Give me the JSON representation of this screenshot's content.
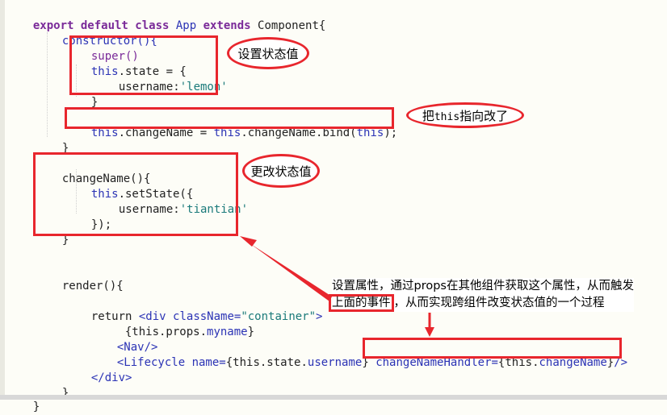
{
  "code": {
    "l1": {
      "a": "export default ",
      "b": "class ",
      "c": "App ",
      "d": "extends ",
      "e": "Component{"
    },
    "l2": {
      "a": "constructor(){"
    },
    "l3": {
      "a": "super()"
    },
    "l4": {
      "a": "this",
      ".b": "",
      "b": ".state = {"
    },
    "l5": {
      "a": "username:",
      "b": "'lemon'"
    },
    "l6": {
      "a": "}"
    },
    "l7": {
      "a": "this",
      "b": ".changeName = ",
      "c": "this",
      "d": ".changeName.bind(",
      "e": "this",
      "f": ");"
    },
    "l8": {
      "a": "}"
    },
    "l9": {
      "a": "changeName(){"
    },
    "l10": {
      "a": "this",
      "b": ".setState({"
    },
    "l11": {
      "a": "username:",
      "b": "'tiantian'"
    },
    "l12": {
      "a": "});"
    },
    "l13": {
      "a": "}"
    },
    "l14": {
      "a": "render(){"
    },
    "l15": {
      "a": "return ",
      "b": "<div ",
      "c": "className=",
      "d": "\"container\"",
      "e": ">"
    },
    "l16": {
      "a": "{this.props.",
      "b": "myname",
      "c": "}"
    },
    "l17": {
      "a": "<Nav/>"
    },
    "l18": {
      "a": "<Lifecycle ",
      "b": "name=",
      "c": "{this.state.",
      "d": "username",
      "e": "}",
      "f": "changeNameHandler=",
      "g": "{this.",
      "h": "changeName",
      "i": "}",
      "j": "/>"
    },
    "l19": {
      "a": "</div>"
    },
    "l20": {
      "a": "}"
    },
    "l21": {
      "a": "}"
    }
  },
  "annotations": {
    "set_state_value": "设置状态值",
    "this_changed_prefix": "把",
    "this_changed_mono": "this",
    "this_changed_suffix": "指向改了",
    "change_state_value": "更改状态值",
    "props_line1": "设置属性，通过props在其他组件获取这个属性，从而触发",
    "props_line2_boxed": "上面的事件",
    "props_line2_rest": "，从而实现跨组件改变状态值的一个过程"
  },
  "colors": {
    "highlight": "#e8262d",
    "keyword": "#7a2a99",
    "identifier": "#2b33b5",
    "string": "#1a7a7a"
  }
}
